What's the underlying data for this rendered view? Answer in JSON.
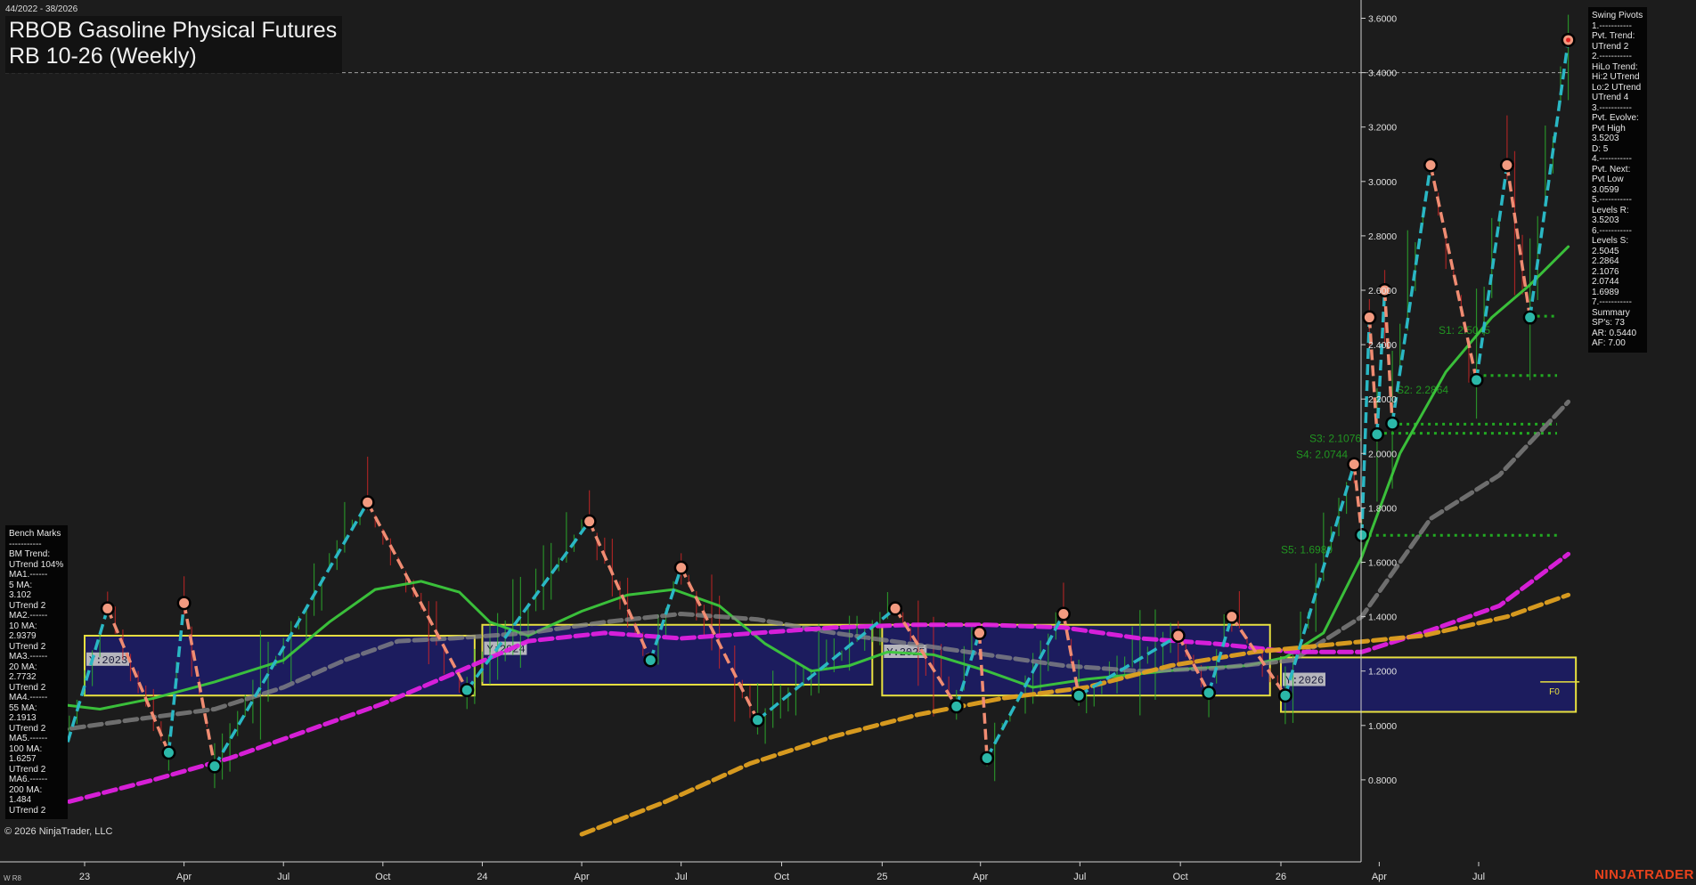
{
  "header": {
    "date_range": "44/2022 - 38/2026",
    "title_line1": "RBOB Gasoline Physical Futures",
    "title_line2": "RB 10-26 (Weekly)"
  },
  "benchmarks_panel": {
    "lines": [
      "Bench Marks",
      "-----------",
      "BM Trend:",
      "UTrend 104%",
      "MA1.------",
      "5 MA:",
      "3.102",
      "UTrend 2",
      "MA2.------",
      "10 MA:",
      "2.9379",
      "UTrend 2",
      "MA3.------",
      "20 MA:",
      "2.7732",
      "UTrend 2",
      "MA4.------",
      "55 MA:",
      "2.1913",
      "UTrend 2",
      "MA5.------",
      "100 MA:",
      "1.6257",
      "UTrend 2",
      "MA6.------",
      "200 MA:",
      "1.484",
      "UTrend 2"
    ]
  },
  "pivots_panel": {
    "lines": [
      "Swing Pivots",
      "1.-----------",
      "Pvt. Trend:",
      "UTrend 2",
      "2.-----------",
      "HiLo Trend:",
      "Hi:2 UTrend",
      "Lo:2 UTrend",
      "UTrend 4",
      "3.-----------",
      "Pvt. Evolve:",
      "Pvt High",
      "3.5203",
      "D: 5",
      "4.-----------",
      "Pvt. Next:",
      "Pvt Low",
      "3.0599",
      "5.-----------",
      "Levels R:",
      "3.5203",
      "6.-----------",
      "Levels S:",
      "2.5045",
      "2.2864",
      "2.1076",
      "2.0744",
      "1.6989",
      "7.-----------",
      "Summary",
      "SP's: 73",
      "AR: 0.5440",
      "AF: 7.00"
    ]
  },
  "footer": {
    "copyright": "© 2026 NinjaTrader, LLC",
    "bottom_left": "W R8",
    "brand": "NINJATRADER"
  },
  "colors": {
    "background": "#1c1c1c",
    "up_leg": "#2ab7c4",
    "down_leg": "#f08c72",
    "ma_green": "#3cc83c",
    "ma_gray": "#8a8a8a",
    "ma_magenta": "#e020e0",
    "ma_orange": "#e0a020",
    "year_box": "#e8e040",
    "year_fill": "#1c1c5e",
    "support": "#22aa22"
  },
  "chart_data": {
    "type": "line",
    "instrument": "RBOB Gasoline Physical Futures RB 10-26 (Weekly)",
    "ylim": [
      0.8,
      3.6
    ],
    "y_ticks": [
      "3.6000",
      "3.4000",
      "3.2000",
      "3.0000",
      "2.8000",
      "2.6000",
      "2.4000",
      "2.2000",
      "2.0000",
      "1.8000",
      "1.6000",
      "1.4000",
      "1.2000",
      "1.0000",
      "0.8000"
    ],
    "x_ticks": [
      {
        "label": "23",
        "x": "2023-01-02"
      },
      {
        "label": "Apr",
        "x": "2023-04-03"
      },
      {
        "label": "Jul",
        "x": "2023-07-03"
      },
      {
        "label": "Oct",
        "x": "2023-10-02"
      },
      {
        "label": "24",
        "x": "2024-01-01"
      },
      {
        "label": "Apr",
        "x": "2024-04-01"
      },
      {
        "label": "Jul",
        "x": "2024-07-01"
      },
      {
        "label": "Oct",
        "x": "2024-10-01"
      },
      {
        "label": "25",
        "x": "2025-01-01"
      },
      {
        "label": "Apr",
        "x": "2025-04-01"
      },
      {
        "label": "Jul",
        "x": "2025-07-01"
      },
      {
        "label": "Oct",
        "x": "2025-10-01"
      },
      {
        "label": "26",
        "x": "2026-01-01"
      },
      {
        "label": "Apr",
        "x": "2026-04-01"
      },
      {
        "label": "Jul",
        "x": "2026-07-01"
      }
    ],
    "swing_pivots": [
      {
        "x": "2022-12-05",
        "y": 0.77,
        "type": "low"
      },
      {
        "x": "2023-01-23",
        "y": 1.43,
        "type": "high"
      },
      {
        "x": "2023-03-20",
        "y": 0.9,
        "type": "low"
      },
      {
        "x": "2023-04-03",
        "y": 1.45,
        "type": "high"
      },
      {
        "x": "2023-05-01",
        "y": 0.85,
        "type": "low"
      },
      {
        "x": "2023-09-18",
        "y": 1.82,
        "type": "high"
      },
      {
        "x": "2023-12-18",
        "y": 1.13,
        "type": "low"
      },
      {
        "x": "2024-04-08",
        "y": 1.75,
        "type": "high"
      },
      {
        "x": "2024-06-03",
        "y": 1.24,
        "type": "low"
      },
      {
        "x": "2024-07-01",
        "y": 1.58,
        "type": "high"
      },
      {
        "x": "2024-09-09",
        "y": 1.02,
        "type": "low"
      },
      {
        "x": "2025-01-13",
        "y": 1.43,
        "type": "high"
      },
      {
        "x": "2025-03-10",
        "y": 1.07,
        "type": "low"
      },
      {
        "x": "2025-03-31",
        "y": 1.34,
        "type": "high"
      },
      {
        "x": "2025-04-07",
        "y": 0.88,
        "type": "low"
      },
      {
        "x": "2025-06-16",
        "y": 1.41,
        "type": "high"
      },
      {
        "x": "2025-06-30",
        "y": 1.11,
        "type": "low"
      },
      {
        "x": "2025-09-29",
        "y": 1.33,
        "type": "high"
      },
      {
        "x": "2025-10-27",
        "y": 1.12,
        "type": "low"
      },
      {
        "x": "2025-11-17",
        "y": 1.4,
        "type": "high"
      },
      {
        "x": "2026-01-05",
        "y": 1.11,
        "type": "low"
      },
      {
        "x": "2026-03-09",
        "y": 1.96,
        "type": "high"
      },
      {
        "x": "2026-03-16",
        "y": 1.7,
        "type": "low"
      },
      {
        "x": "2026-03-23",
        "y": 2.5,
        "type": "high"
      },
      {
        "x": "2026-03-30",
        "y": 2.07,
        "type": "low"
      },
      {
        "x": "2026-04-06",
        "y": 2.6,
        "type": "high"
      },
      {
        "x": "2026-04-13",
        "y": 2.11,
        "type": "low"
      },
      {
        "x": "2026-05-18",
        "y": 3.06,
        "type": "high"
      },
      {
        "x": "2026-06-29",
        "y": 2.27,
        "type": "low"
      },
      {
        "x": "2026-07-27",
        "y": 3.06,
        "type": "high"
      },
      {
        "x": "2026-08-17",
        "y": 2.5,
        "type": "low"
      },
      {
        "x": "2026-09-21",
        "y": 3.52,
        "type": "high"
      }
    ],
    "moving_averages": [
      {
        "name": "20 MA",
        "color": "#3cc83c",
        "dash": false,
        "points": [
          [
            "2022-12-05",
            1.08
          ],
          [
            "2023-01-16",
            1.06
          ],
          [
            "2023-03-06",
            1.1
          ],
          [
            "2023-05-01",
            1.16
          ],
          [
            "2023-07-03",
            1.24
          ],
          [
            "2023-08-14",
            1.38
          ],
          [
            "2023-09-25",
            1.5
          ],
          [
            "2023-11-06",
            1.53
          ],
          [
            "2023-12-11",
            1.49
          ],
          [
            "2024-01-08",
            1.38
          ],
          [
            "2024-02-12",
            1.33
          ],
          [
            "2024-04-01",
            1.42
          ],
          [
            "2024-05-13",
            1.48
          ],
          [
            "2024-06-24",
            1.5
          ],
          [
            "2024-08-05",
            1.44
          ],
          [
            "2024-09-16",
            1.3
          ],
          [
            "2024-10-28",
            1.2
          ],
          [
            "2024-12-02",
            1.22
          ],
          [
            "2025-01-06",
            1.27
          ],
          [
            "2025-02-17",
            1.26
          ],
          [
            "2025-04-07",
            1.2
          ],
          [
            "2025-05-19",
            1.14
          ],
          [
            "2025-07-07",
            1.17
          ],
          [
            "2025-08-25",
            1.19
          ],
          [
            "2025-10-13",
            1.21
          ],
          [
            "2025-12-01",
            1.22
          ],
          [
            "2026-01-05",
            1.25
          ],
          [
            "2026-02-09",
            1.34
          ],
          [
            "2026-03-16",
            1.62
          ],
          [
            "2026-04-20",
            2.0
          ],
          [
            "2026-06-01",
            2.3
          ],
          [
            "2026-07-13",
            2.5
          ],
          [
            "2026-08-17",
            2.62
          ],
          [
            "2026-09-21",
            2.76
          ]
        ]
      },
      {
        "name": "55 MA",
        "color": "#8a8a8a",
        "dash": true,
        "points": [
          [
            "2022-12-05",
            0.98
          ],
          [
            "2023-02-13",
            1.02
          ],
          [
            "2023-05-01",
            1.06
          ],
          [
            "2023-07-03",
            1.14
          ],
          [
            "2023-08-28",
            1.24
          ],
          [
            "2023-10-16",
            1.31
          ],
          [
            "2023-12-04",
            1.32
          ],
          [
            "2024-02-12",
            1.34
          ],
          [
            "2024-04-22",
            1.38
          ],
          [
            "2024-07-01",
            1.41
          ],
          [
            "2024-09-09",
            1.39
          ],
          [
            "2024-11-18",
            1.34
          ],
          [
            "2025-01-27",
            1.3
          ],
          [
            "2025-04-07",
            1.26
          ],
          [
            "2025-06-16",
            1.22
          ],
          [
            "2025-08-25",
            1.2
          ],
          [
            "2025-11-03",
            1.21
          ],
          [
            "2026-01-12",
            1.24
          ],
          [
            "2026-03-16",
            1.4
          ],
          [
            "2026-05-18",
            1.76
          ],
          [
            "2026-07-20",
            1.92
          ],
          [
            "2026-09-21",
            2.19
          ]
        ]
      },
      {
        "name": "100 MA",
        "color": "#e020e0",
        "dash": true,
        "points": [
          [
            "2022-12-19",
            0.72
          ],
          [
            "2023-03-06",
            0.8
          ],
          [
            "2023-05-15",
            0.88
          ],
          [
            "2023-07-24",
            0.98
          ],
          [
            "2023-10-02",
            1.08
          ],
          [
            "2023-12-11",
            1.2
          ],
          [
            "2024-02-12",
            1.31
          ],
          [
            "2024-04-22",
            1.34
          ],
          [
            "2024-07-01",
            1.32
          ],
          [
            "2024-09-09",
            1.34
          ],
          [
            "2024-11-18",
            1.36
          ],
          [
            "2025-01-27",
            1.37
          ],
          [
            "2025-04-07",
            1.37
          ],
          [
            "2025-06-16",
            1.36
          ],
          [
            "2025-08-25",
            1.32
          ],
          [
            "2025-11-03",
            1.3
          ],
          [
            "2026-01-12",
            1.27
          ],
          [
            "2026-03-16",
            1.27
          ],
          [
            "2026-05-18",
            1.35
          ],
          [
            "2026-07-20",
            1.44
          ],
          [
            "2026-09-21",
            1.63
          ]
        ]
      },
      {
        "name": "200 MA",
        "color": "#e0a020",
        "dash": true,
        "points": [
          [
            "2024-04-01",
            0.6
          ],
          [
            "2024-06-17",
            0.72
          ],
          [
            "2024-09-02",
            0.86
          ],
          [
            "2024-11-18",
            0.96
          ],
          [
            "2025-02-03",
            1.04
          ],
          [
            "2025-04-21",
            1.1
          ],
          [
            "2025-07-07",
            1.14
          ],
          [
            "2025-09-22",
            1.22
          ],
          [
            "2025-12-08",
            1.27
          ],
          [
            "2026-02-23",
            1.3
          ],
          [
            "2026-05-11",
            1.33
          ],
          [
            "2026-07-27",
            1.4
          ],
          [
            "2026-09-21",
            1.48
          ]
        ]
      }
    ],
    "support_levels": [
      {
        "label": "S1: 2.5045",
        "value": 2.5045
      },
      {
        "label": "S2: 2.2864",
        "value": 2.2864
      },
      {
        "label": "S3: 2.1076",
        "value": 2.1076
      },
      {
        "label": "S4: 2.0744",
        "value": 2.0744
      },
      {
        "label": "S5: 1.6989",
        "value": 1.6989
      }
    ],
    "resistance_level": 3.4,
    "year_boxes": [
      {
        "label": "Y:2023",
        "x0": "2023-01-02",
        "x1": "2023-12-25",
        "ymin": 1.11,
        "ymax": 1.33
      },
      {
        "label": "Y:2024",
        "x0": "2024-01-01",
        "x1": "2024-12-23",
        "ymin": 1.15,
        "ymax": 1.37
      },
      {
        "label": "Y:2025",
        "x0": "2025-01-01",
        "x1": "2025-12-22",
        "ymin": 1.11,
        "ymax": 1.37
      },
      {
        "label": "Y:2026",
        "x0": "2026-01-01",
        "x1": "2026-09-28",
        "ymin": 1.05,
        "ymax": 1.25
      }
    ],
    "f0_label": "F0",
    "f0_value": 1.16
  }
}
